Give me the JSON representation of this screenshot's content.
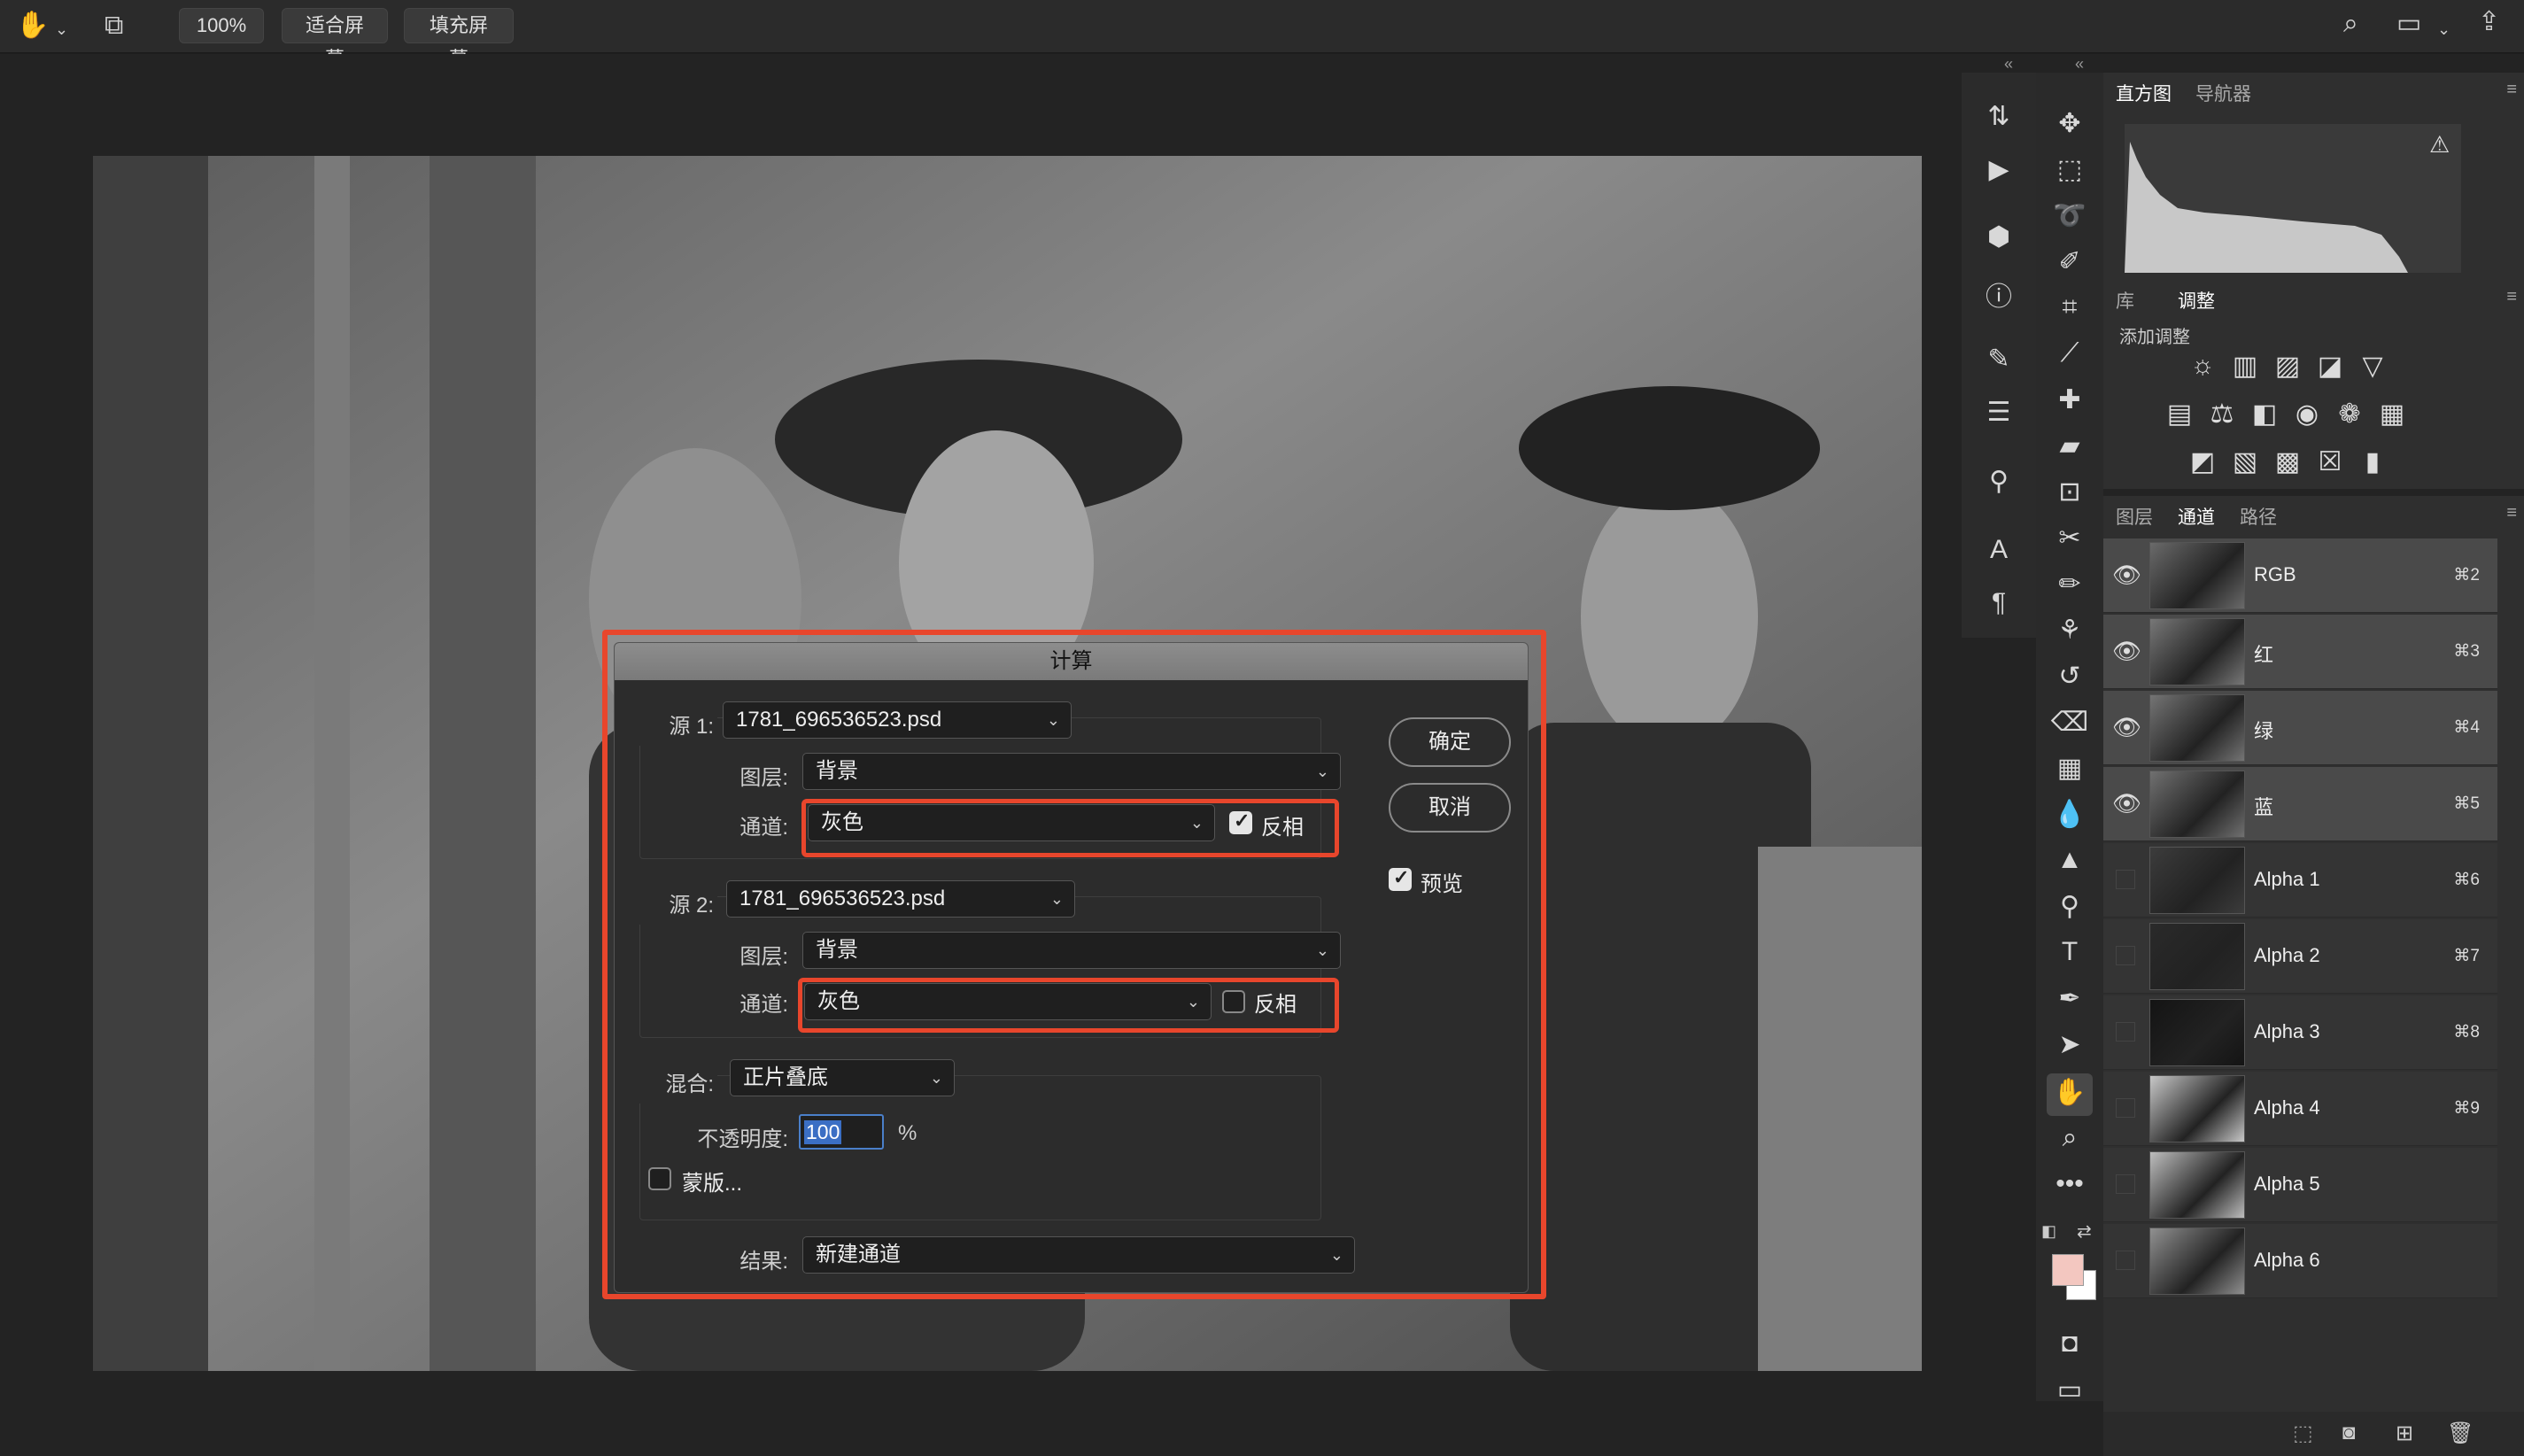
{
  "topbar": {
    "zoom_label": "100%",
    "fit_screen_label": "适合屏幕",
    "fill_screen_label": "填充屏幕"
  },
  "dialog": {
    "title": "计算",
    "source1": {
      "label": "源 1:",
      "file": "1781_696536523.psd",
      "layer_label": "图层:",
      "layer_value": "背景",
      "channel_label": "通道:",
      "channel_value": "灰色",
      "invert_label": "反相",
      "invert_checked": true
    },
    "source2": {
      "label": "源 2:",
      "file": "1781_696536523.psd",
      "layer_label": "图层:",
      "layer_value": "背景",
      "channel_label": "通道:",
      "channel_value": "灰色",
      "invert_label": "反相",
      "invert_checked": false
    },
    "blend_label": "混合:",
    "blend_value": "正片叠底",
    "opacity_label": "不透明度:",
    "opacity_value": "100",
    "opacity_unit": "%",
    "mask_label": "蒙版...",
    "result_label": "结果:",
    "result_value": "新建通道",
    "ok_label": "确定",
    "cancel_label": "取消",
    "preview_label": "预览",
    "preview_checked": true
  },
  "panels": {
    "top_tabs": [
      "直方图",
      "导航器"
    ],
    "adjust_tabs": [
      "库",
      "调整"
    ],
    "add_adjustment_label": "添加调整",
    "layer_tabs": [
      "图层",
      "通道",
      "路径"
    ]
  },
  "channels": [
    {
      "name": "RGB",
      "shortcut": "⌘2",
      "visible": true
    },
    {
      "name": "红",
      "shortcut": "⌘3",
      "visible": true
    },
    {
      "name": "绿",
      "shortcut": "⌘4",
      "visible": true
    },
    {
      "name": "蓝",
      "shortcut": "⌘5",
      "visible": true
    },
    {
      "name": "Alpha 1",
      "shortcut": "⌘6",
      "visible": false
    },
    {
      "name": "Alpha 2",
      "shortcut": "⌘7",
      "visible": false
    },
    {
      "name": "Alpha 3",
      "shortcut": "⌘8",
      "visible": false
    },
    {
      "name": "Alpha 4",
      "shortcut": "⌘9",
      "visible": false
    },
    {
      "name": "Alpha 5",
      "shortcut": "",
      "visible": false
    },
    {
      "name": "Alpha 6",
      "shortcut": "",
      "visible": false
    }
  ],
  "colors": {
    "highlight": "#e8462c",
    "foreground_swatch": "#f3c7c0",
    "background_swatch": "#ffffff"
  }
}
